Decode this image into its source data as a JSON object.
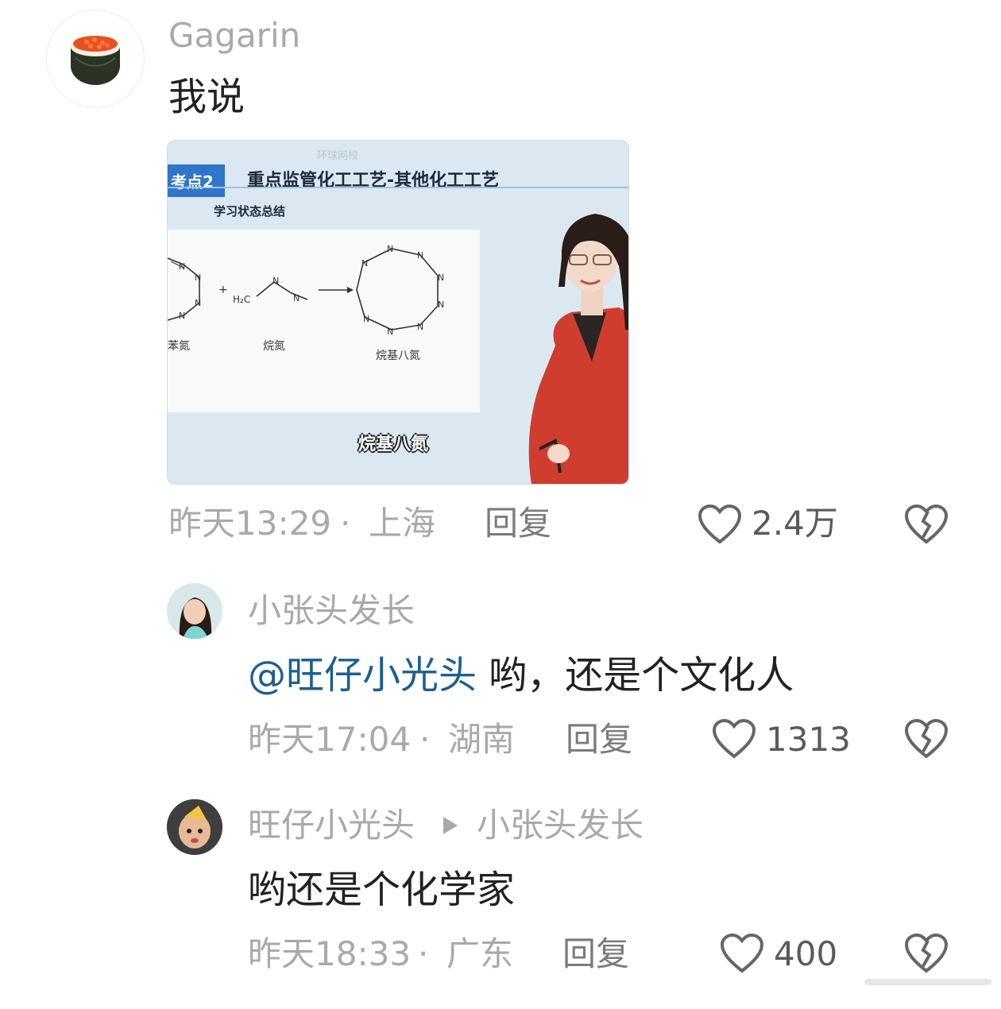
{
  "comments": [
    {
      "author": "Gagarin",
      "text": "我说",
      "time": "昨天13:29",
      "location": "上海",
      "reply_label": "回复",
      "likes": "2.4万",
      "media": {
        "tag": "考点2",
        "title": "重点监管化工工艺-其他化工工艺",
        "subtitle": "学习状态总结",
        "watermark": "环球网校",
        "labels": [
          "苯氮",
          "烷氮",
          "烷基八氮"
        ],
        "formula_left": "H₂C",
        "caption": "烷基八氮"
      }
    },
    {
      "author": "小张头发长",
      "mention": "@旺仔小光头",
      "text": " 哟，还是个文化人",
      "time": "昨天17:04",
      "location": "湖南",
      "reply_label": "回复",
      "likes": "1313"
    },
    {
      "author": "旺仔小光头",
      "reply_to": "小张头发长",
      "text": "哟还是个化学家",
      "time": "昨天18:33",
      "location": "广东",
      "reply_label": "回复",
      "likes": "400"
    }
  ],
  "separator": "·",
  "icons": {
    "like": "heart-outline-icon",
    "dislike": "broken-heart-icon",
    "reply_arrow": "play-triangle-icon"
  },
  "colors": {
    "mention": "#1d5f8f",
    "muted": "#a9a9a9",
    "text": "#222222"
  }
}
